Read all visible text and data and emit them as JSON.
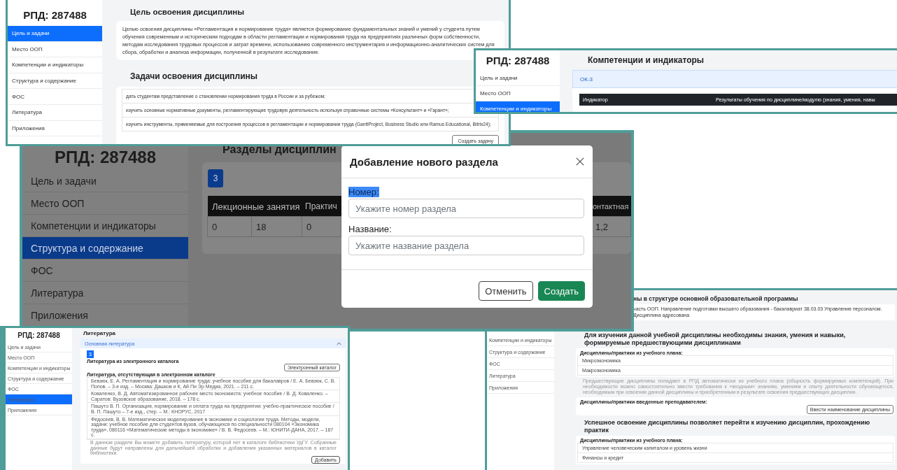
{
  "screens": [
    {
      "kind": "goals",
      "sidebar": {
        "title": "РПД: 287488",
        "items": [
          {
            "label": "Цель и задачи",
            "selected": true
          },
          {
            "label": "Место ООП",
            "selected": false
          },
          {
            "label": "Компетенции и индикаторы",
            "selected": false
          },
          {
            "label": "Структура и содержание",
            "selected": false
          },
          {
            "label": "ФОС",
            "selected": false
          },
          {
            "label": "Литература",
            "selected": false
          },
          {
            "label": "Приложения",
            "selected": false
          }
        ]
      },
      "goal_heading": "Цель освоения дисциплины",
      "goal_text": "Целью освоения дисциплины «Регламентация и нормирование труда» является формирование фундаментальных знаний и умений у студента путем обучения современным и историческим подходам в области регламентации и нормирования труда на предприятиях различных форм собственности, методам исследования трудовых процессов и затрат времени, использованию современного инструментария и информационно-аналитических систем для сбора, обработки и анализа информации, полученной в результате исследования.",
      "tasks_heading": "Задачи освоения дисциплины",
      "tasks": [
        "дать студентам представление о становлении нормирования труда в России и за рубежом;",
        "изучить основные нормативные документы, регламентирующие трудовую деятельность используя справочные системы «Консультант» и «Гарант»;",
        "изучить инструменты, применяемые для построения процессов в регламентации и нормировании труда (GanttProject, Business Studio или Ramus Educational, Bitrix24);"
      ],
      "create_button": "Создать задачу"
    },
    {
      "kind": "competences",
      "sidebar": {
        "title": "РПД: 287488",
        "items": [
          {
            "label": "Цель и задачи",
            "selected": false
          },
          {
            "label": "Место ООП",
            "selected": false
          },
          {
            "label": "Компетенции и индикаторы",
            "selected": true
          }
        ]
      },
      "heading": "Компетенции и индикаторы",
      "competence": "ОК-3",
      "columns": [
        "Индикатор",
        "Результаты обучения по дисциплине/модулю (знания, умения, навы"
      ]
    },
    {
      "kind": "structure",
      "sidebar": {
        "title": "РПД: 287488",
        "items": [
          {
            "label": "Цель и задачи",
            "selected": false
          },
          {
            "label": "Место ООП",
            "selected": false
          },
          {
            "label": "Компетенции и индикаторы",
            "selected": false
          },
          {
            "label": "Структура и содержание",
            "selected": true
          },
          {
            "label": "ФОС",
            "selected": false
          },
          {
            "label": "Литература",
            "selected": false
          },
          {
            "label": "Приложения",
            "selected": false
          }
        ]
      },
      "heading": "Разделы дисциплин",
      "section_count": "3",
      "columns": [
        "Лекционные занятия",
        "Практич",
        "онтактная"
      ],
      "row": [
        "0",
        "18",
        "0",
        "1,2"
      ],
      "dialog": {
        "title": "Добавление нового раздела",
        "fields": [
          {
            "label": "Номер:",
            "placeholder": "Укажите номер раздела",
            "highlighted": true
          },
          {
            "label": "Название:",
            "placeholder": "Укажите название раздела",
            "highlighted": false
          }
        ],
        "buttons": [
          {
            "label": "Отменить",
            "kind": "secondary"
          },
          {
            "label": "Создать",
            "kind": "primary"
          }
        ]
      }
    },
    {
      "kind": "literature",
      "sidebar": {
        "title": "РПД: 287488",
        "items": [
          {
            "label": "Цель и задачи",
            "selected": false
          },
          {
            "label": "Место ООП",
            "selected": false
          },
          {
            "label": "Компетенции и индикаторы",
            "selected": false
          },
          {
            "label": "Структура и содержание",
            "selected": false
          },
          {
            "label": "ФОС",
            "selected": false
          },
          {
            "label": "Литература",
            "selected": true
          },
          {
            "label": "Приложения",
            "selected": false
          }
        ]
      },
      "heading": "Литература",
      "accordion": {
        "title": "Основная литература",
        "expanded": true
      },
      "section_count": "3",
      "catalog_label": "Литература из электронного каталога",
      "catalog_button": "Электронный каталог",
      "missing_label": "Литература, отсутствующая в электронном каталоге",
      "books": [
        "Бевзюк, Е. А. Регламентация и нормирование труда: учебное пособие для бакалавров / Е. А. Бевзюк, С. В. Попов. – 3-е изд. – Москва: Дашков и К, Ай Пи Эр Медиа, 2021. – 211 с.",
        "Коваленко, В. Д. Автоматизированное рабочее место экономиста: учебное пособие / В. Д. Коваленко. – Саратов: Вузовское образование, 2018. – 178 с.",
        "Пашуто В. П. Организация, нормирование и оплата труда на предприятии: учебно-практическое пособие / В. П. Пашуто – 7-е изд., стер. – М.: КНОРУС, 2017",
        "Федосеев, В. В. Математическое моделирование в экономике и социологии труда. Методы, модели, задачи: учебное пособие для студентов вузов, обучающихся по специальности 080104 «Экономика труда», 080116 «Математические методы в экономике» / В. В. Федосеев. – М.: ЮНИТИ-ДАНА, 2017. – 167 с."
      ],
      "note": "В данном разделе Вы можете добавить литературу, которой нет в каталоге библиотеки УдГУ. Собранные данные будут направлены для дальнейшей обработки и добавления указанных материалов в каталог библиотеки.",
      "add_button": "Добавить"
    },
    {
      "kind": "place",
      "sidebar": {
        "items": [
          {
            "label": "Компетенции и индикаторы",
            "selected": false
          },
          {
            "label": "Структура и содержание",
            "selected": false
          },
          {
            "label": "ФОС",
            "selected": false
          },
          {
            "label": "Литература",
            "selected": false
          },
          {
            "label": "Приложения",
            "selected": false
          }
        ]
      },
      "heading": "ны в структуре основной образовательной программы",
      "description": "часть ООП. Направление подготовки высшего образования - бакалавриат 38.03.03 Управление персоналом. Дисциплина адресована",
      "prerequisites": {
        "heading": "Для изучения данной учебной дисциплины необходимы знания, умения и навыки, формируемые предшествующими дисциплинами",
        "plan_label": "Дисциплины/практики из учебного плана:",
        "items": [
          "Микроэкономика",
          "Макроэкономика"
        ],
        "note": "Предшествующие дисциплины попадают в РПД автоматически из учебного плана (общность формируемых компетенций). При необходимости можно самостоятельно ввести требования к «входным» знаниям, умениям и опыту деятельности обучающегося, необходимым при освоении данной дисциплины и приобретенным в результате освоения предшествующих дисциплин.",
        "teacher_label": "Дисциплины/практики введенные преподавателем:",
        "add_button": "Ввести наименование дисциплины"
      },
      "followups": {
        "heading": "Успешное освоение дисциплины позволяет перейти к изучению дисциплин, прохождению практик",
        "plan_label": "Дисциплины/практики из учебного плана:",
        "items": [
          "Управление человеческим капиталом и уровень жизни",
          "Финансы и кредит"
        ]
      }
    }
  ]
}
